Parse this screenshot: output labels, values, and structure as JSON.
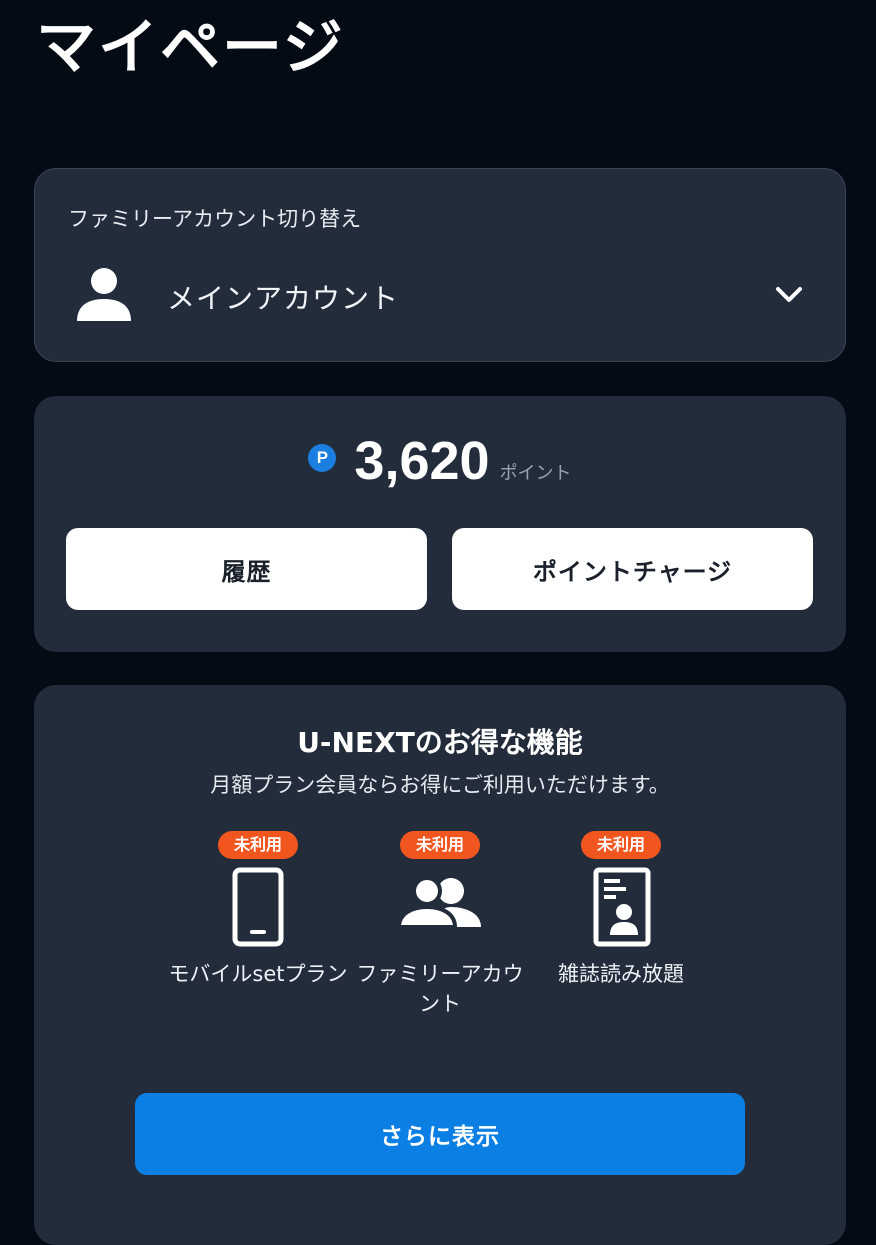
{
  "page": {
    "title": "マイページ"
  },
  "account_switcher": {
    "label": "ファミリーアカウント切り替え",
    "current_account": "メインアカウント",
    "avatar_icon": "person-icon",
    "toggle_icon": "chevron-down-icon"
  },
  "points": {
    "badge": "P",
    "value": "3,620",
    "unit": "ポイント",
    "history_button": "履歴",
    "charge_button": "ポイントチャージ"
  },
  "features": {
    "title": "U-NEXTのお得な機能",
    "subtitle": "月額プラン会員ならお得にご利用いただけます。",
    "items": [
      {
        "badge": "未利用",
        "label": "モバイルsetプラン",
        "icon": "smartphone-icon"
      },
      {
        "badge": "未利用",
        "label": "ファミリーアカウント",
        "icon": "people-icon"
      },
      {
        "badge": "未利用",
        "label": "雑誌読み放題",
        "icon": "magazine-icon"
      }
    ],
    "more_button": "さらに表示"
  },
  "colors": {
    "background": "#040b15",
    "card": "#232c3b",
    "accent_blue": "#0b7fe3",
    "badge_orange": "#f2561f"
  }
}
